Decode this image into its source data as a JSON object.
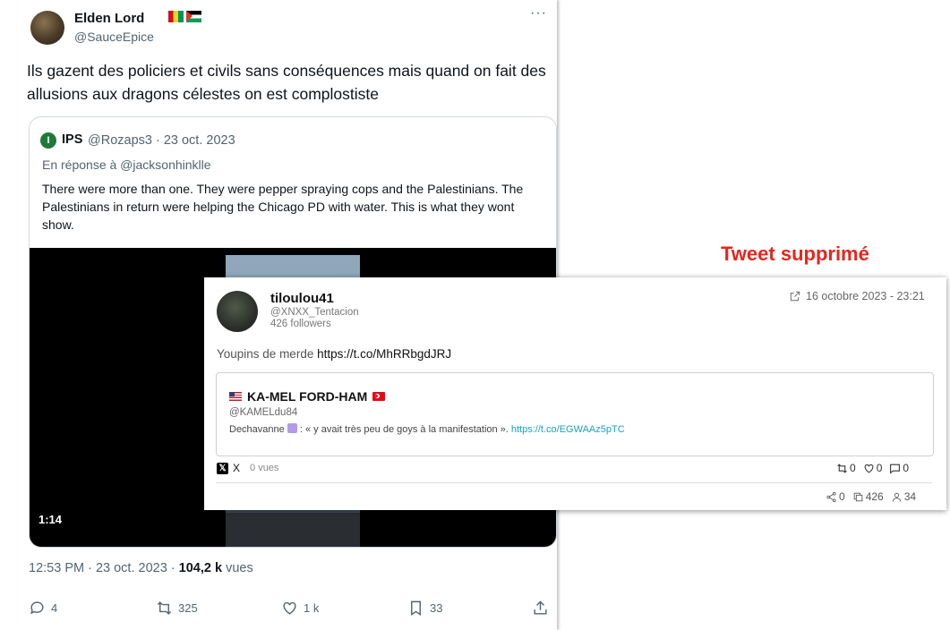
{
  "tweet": {
    "name": "Elden Lord",
    "handle": "@SauceEpice",
    "more": "···",
    "text": "Ils gazent des policiers et civils sans conséquences mais quand on fait des allusions aux dragons célestes on est complostiste",
    "quote": {
      "avatar_letter": "I",
      "name": "IPS",
      "meta": "@Rozaps3 · 23 oct. 2023",
      "reply_to": "En réponse à @jacksonhinklle",
      "text": "There were more than one. They were pepper spraying cops and the Palestinians. The Palestinians in return were helping the Chicago PD with water. This is what they wont show.",
      "video_duration": "1:14"
    },
    "time": "12:53 PM · 23 oct. 2023 · ",
    "views_count": "104,2 k",
    "views_label": " vues",
    "actions": {
      "reply": "4",
      "retweet": "325",
      "like": "1 k",
      "bookmark": "33"
    }
  },
  "deleted": {
    "title": "Tweet supprimé",
    "name": "tiloulou41",
    "handle": "@XNXX_Tentacion",
    "followers": "426 followers",
    "date": "16 octobre 2023 - 23:21",
    "text_prefix": "Youpins de merde ",
    "text_link": "https://t.co/MhRRbgdJRJ",
    "quote": {
      "name": "KA-MEL FORD-HAM",
      "handle": "@KAMELdu84",
      "text_before": "Dechavanne ",
      "text_after": " : « y avait très peu de goys à la manifestation ». ",
      "link": "https://t.co/EGWAAz5pTC"
    },
    "source": "X",
    "views": "0 vues",
    "stats": {
      "retweets": "0",
      "likes": "0",
      "replies": "0"
    },
    "stats2": {
      "shares": "0",
      "copies": "426",
      "followers": "34"
    }
  },
  "colors": {
    "deleted_title": "#e5261e",
    "link": "#1da1c2"
  }
}
